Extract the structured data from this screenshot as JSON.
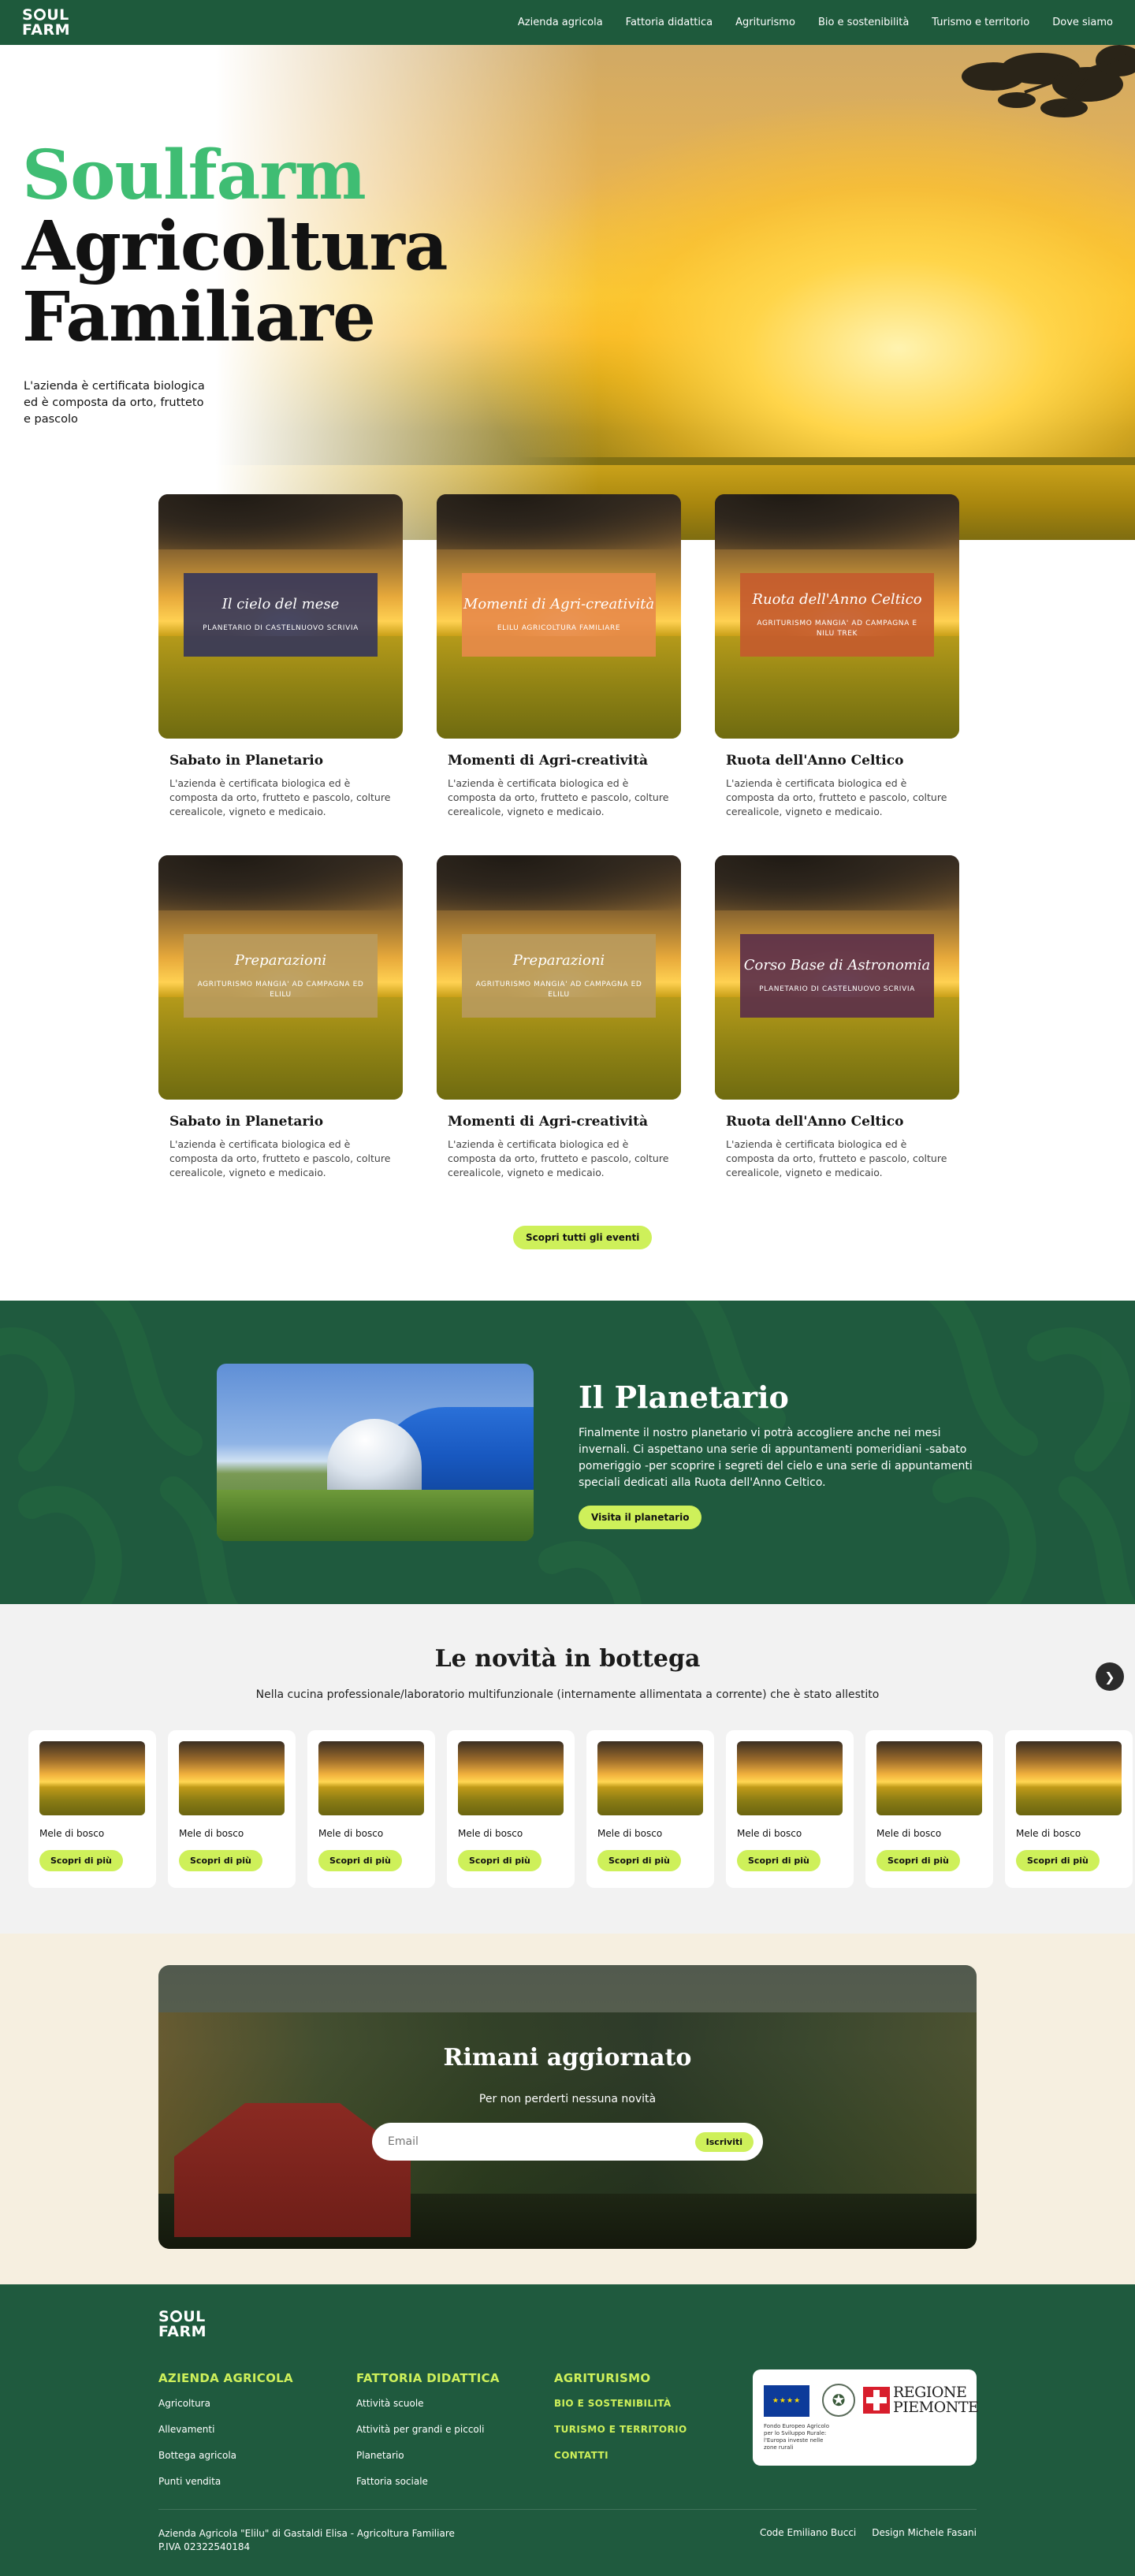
{
  "brand": {
    "logo_top": "SOUL",
    "logo_bottom": "FARM"
  },
  "nav": [
    "Azienda agricola",
    "Fattoria didattica",
    "Agriturismo",
    "Bio e sostenibilità",
    "Turismo e territorio",
    "Dove siamo"
  ],
  "hero": {
    "title_green": "Soulfarm",
    "title_line2": "Agricoltura",
    "title_line3": "Familiare",
    "subtitle": "L'azienda è certificata biologica ed è composta da orto, frutteto e pascolo"
  },
  "events": {
    "cards": [
      {
        "overlay_title": "Il cielo del mese",
        "overlay_sub": "PLANETARIO DI CASTELNUOVO SCRIVIA",
        "overlay_color": "#34355a",
        "title": "Sabato in Planetario",
        "text": "L'azienda è certificata biologica ed è composta da orto, frutteto e pascolo, colture cerealicole, vigneto e medicaio."
      },
      {
        "overlay_title": "Momenti di Agri-creatività",
        "overlay_sub": "ELILU AGRICOLTURA FAMILIARE",
        "overlay_color": "#e88a4a",
        "title": "Momenti di Agri-creatività",
        "text": "L'azienda è certificata biologica ed è composta da orto, frutteto e pascolo, colture cerealicole, vigneto e medicaio."
      },
      {
        "overlay_title": "Ruota dell'Anno Celtico",
        "overlay_sub": "AGRITURISMO MANGIA' AD CAMPAGNA E NILU TREK",
        "overlay_color": "#c45a2e",
        "title": "Ruota dell'Anno Celtico",
        "text": "L'azienda è certificata biologica ed è composta da orto, frutteto e pascolo, colture cerealicole, vigneto e medicaio."
      },
      {
        "overlay_title": "Preparazioni",
        "overlay_sub": "AGRITURISMO MANGIA' AD CAMPAGNA ED ELILU",
        "overlay_color": "#b89a5e",
        "title": "Sabato in Planetario",
        "text": "L'azienda è certificata biologica ed è composta da orto, frutteto e pascolo, colture cerealicole, vigneto e medicaio."
      },
      {
        "overlay_title": "Preparazioni",
        "overlay_sub": "AGRITURISMO MANGIA' AD CAMPAGNA ED ELILU",
        "overlay_color": "#b89a5e",
        "title": "Momenti di Agri-creatività",
        "text": "L'azienda è certificata biologica ed è composta da orto, frutteto e pascolo, colture cerealicole, vigneto e medicaio."
      },
      {
        "overlay_title": "Corso Base di Astronomia",
        "overlay_sub": "PLANETARIO DI CASTELNUOVO SCRIVIA",
        "overlay_color": "#5a2d4a",
        "title": "Ruota dell'Anno Celtico",
        "text": "L'azienda è certificata biologica ed è composta da orto, frutteto e pascolo, colture cerealicole, vigneto e medicaio."
      }
    ],
    "button": "Scopri tutti gli eventi"
  },
  "planetario": {
    "title": "Il Planetario",
    "text": "Finalmente il nostro planetario vi potrà accogliere anche nei mesi invernali. Ci aspettano una serie di appuntamenti pomeridiani -sabato pomeriggio -per scoprire i segreti del cielo e una serie di appuntamenti speciali dedicati alla Ruota dell'Anno Celtico.",
    "button": "Visita il planetario"
  },
  "bottega": {
    "title": "Le novità in bottega",
    "subtitle": "Nella cucina professionale/laboratorio multifunzionale (internamente allimentata a corrente) che è stato allestito",
    "products": [
      {
        "name": "Mele di bosco",
        "button": "Scopri di più"
      },
      {
        "name": "Mele di bosco",
        "button": "Scopri di più"
      },
      {
        "name": "Mele di bosco",
        "button": "Scopri di più"
      },
      {
        "name": "Mele di bosco",
        "button": "Scopri di più"
      },
      {
        "name": "Mele di bosco",
        "button": "Scopri di più"
      },
      {
        "name": "Mele di bosco",
        "button": "Scopri di più"
      },
      {
        "name": "Mele di bosco",
        "button": "Scopri di più"
      },
      {
        "name": "Mele di bosco",
        "button": "Scopri di più"
      }
    ],
    "next_icon": "chevron-right-icon"
  },
  "newsletter": {
    "title": "Rimani aggiornato",
    "subtitle": "Per non perderti nessuna novità",
    "email_placeholder": "Email",
    "button": "Iscriviti"
  },
  "footer": {
    "col1": {
      "title": "AZIENDA AGRICOLA",
      "items": [
        "Agricoltura",
        "Allevamenti",
        "Bottega agricola",
        "Punti vendita"
      ]
    },
    "col2": {
      "title": "FATTORIA DIDATTICA",
      "items": [
        "Attività scuole",
        "Attività per grandi e piccoli",
        "Planetario",
        "Fattoria sociale"
      ]
    },
    "col3": {
      "title": "AGRITURISMO",
      "items": [
        "BIO E SOSTENIBILITÀ",
        "TURISMO E TERRITORIO",
        "CONTATTI"
      ]
    },
    "eu_text": "Fondo Europeo Agricolo per lo Sviluppo Rurale: l'Europa investe nelle zone rurali",
    "region_line1": "REGIONE",
    "region_line2": "PIEMONTE",
    "company_line1": "Azienda Agricola \"Elilu\" di Gastaldi Elisa - Agricoltura Familiare",
    "company_line2": "P.IVA 02322540184",
    "credit_code": "Code Emiliano Bucci",
    "credit_design": "Design Michele Fasani"
  }
}
